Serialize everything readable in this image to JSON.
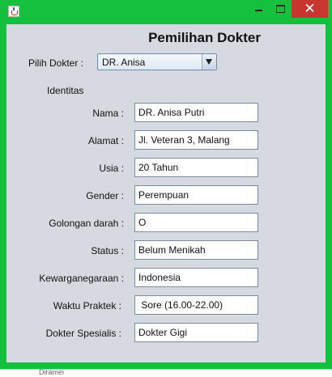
{
  "window": {
    "title": "",
    "controls": {
      "minimize": "",
      "maximize": "",
      "close": "✕"
    },
    "accent_color": "#16c03f"
  },
  "form": {
    "heading": "Pemilihan Dokter",
    "doctor_select": {
      "label": "Pilih Dokter :",
      "selected": "DR. Anisa"
    },
    "section_title": "Identitas",
    "fields": [
      {
        "label": "Nama :",
        "value": "DR. Anisa Putri"
      },
      {
        "label": "Alamat :",
        "value": "Jl. Veteran 3, Malang"
      },
      {
        "label": "Usia :",
        "value": "20 Tahun"
      },
      {
        "label": "Gender :",
        "value": "Perempuan"
      },
      {
        "label": "Golongan darah :",
        "value": "O"
      },
      {
        "label": "Status :",
        "value": "Belum Menikah"
      },
      {
        "label": "Kewarganegaraan :",
        "value": "Indonesia"
      },
      {
        "label": "Waktu Praktek :",
        "value": " Sore (16.00-22.00)"
      },
      {
        "label": "Dokter Spesialis :",
        "value": "Dokter Gigi"
      }
    ]
  },
  "background_fragment": "Diramei"
}
